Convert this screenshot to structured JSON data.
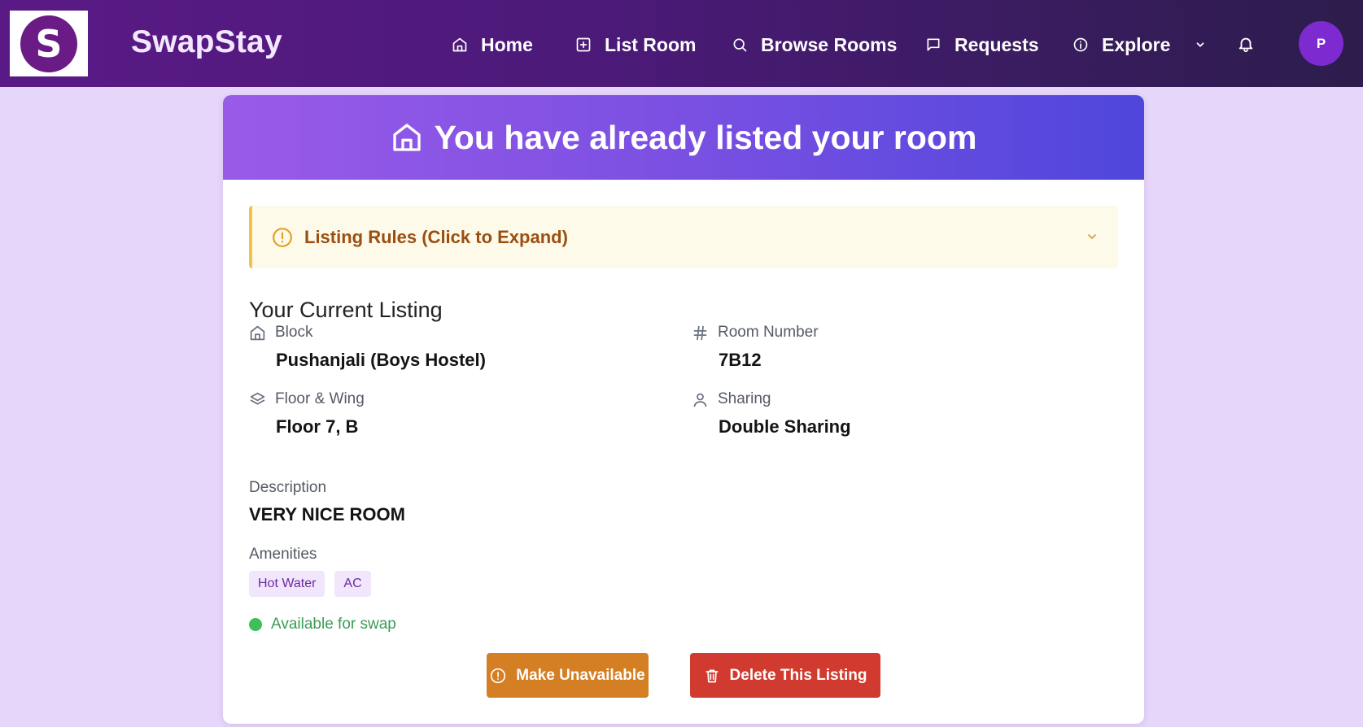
{
  "header": {
    "logo_letter": "S",
    "brand": "SwapStay",
    "nav": [
      {
        "label": "Home",
        "icon": "home-icon"
      },
      {
        "label": "List Room",
        "icon": "plus-square-icon"
      },
      {
        "label": "Browse Rooms",
        "icon": "search-icon"
      },
      {
        "label": "Requests",
        "icon": "message-icon"
      },
      {
        "label": "Explore",
        "icon": "info-icon"
      }
    ],
    "avatar_initial": "P"
  },
  "card": {
    "title": "You have already listed your room",
    "rules_label": "Listing Rules (Click to Expand)",
    "section_title": "Your Current Listing",
    "block": {
      "label": "Block",
      "value": "Pushanjali (Boys Hostel)"
    },
    "room_number": {
      "label": "Room Number",
      "value": "7B12"
    },
    "floor_wing": {
      "label": "Floor & Wing",
      "value": "Floor 7, B"
    },
    "sharing": {
      "label": "Sharing",
      "value": "Double Sharing"
    },
    "description": {
      "label": "Description",
      "value": "VERY NICE ROOM"
    },
    "amenities": {
      "label": "Amenities",
      "items": [
        "Hot Water",
        "AC"
      ]
    },
    "status": "Available for swap",
    "buttons": {
      "make_unavailable": "Make Unavailable",
      "delete": "Delete This Listing"
    }
  },
  "colors": {
    "accent": "#7a50e2",
    "warning": "#d47f24",
    "danger": "#d13a2e",
    "success": "#3fbf5c"
  }
}
